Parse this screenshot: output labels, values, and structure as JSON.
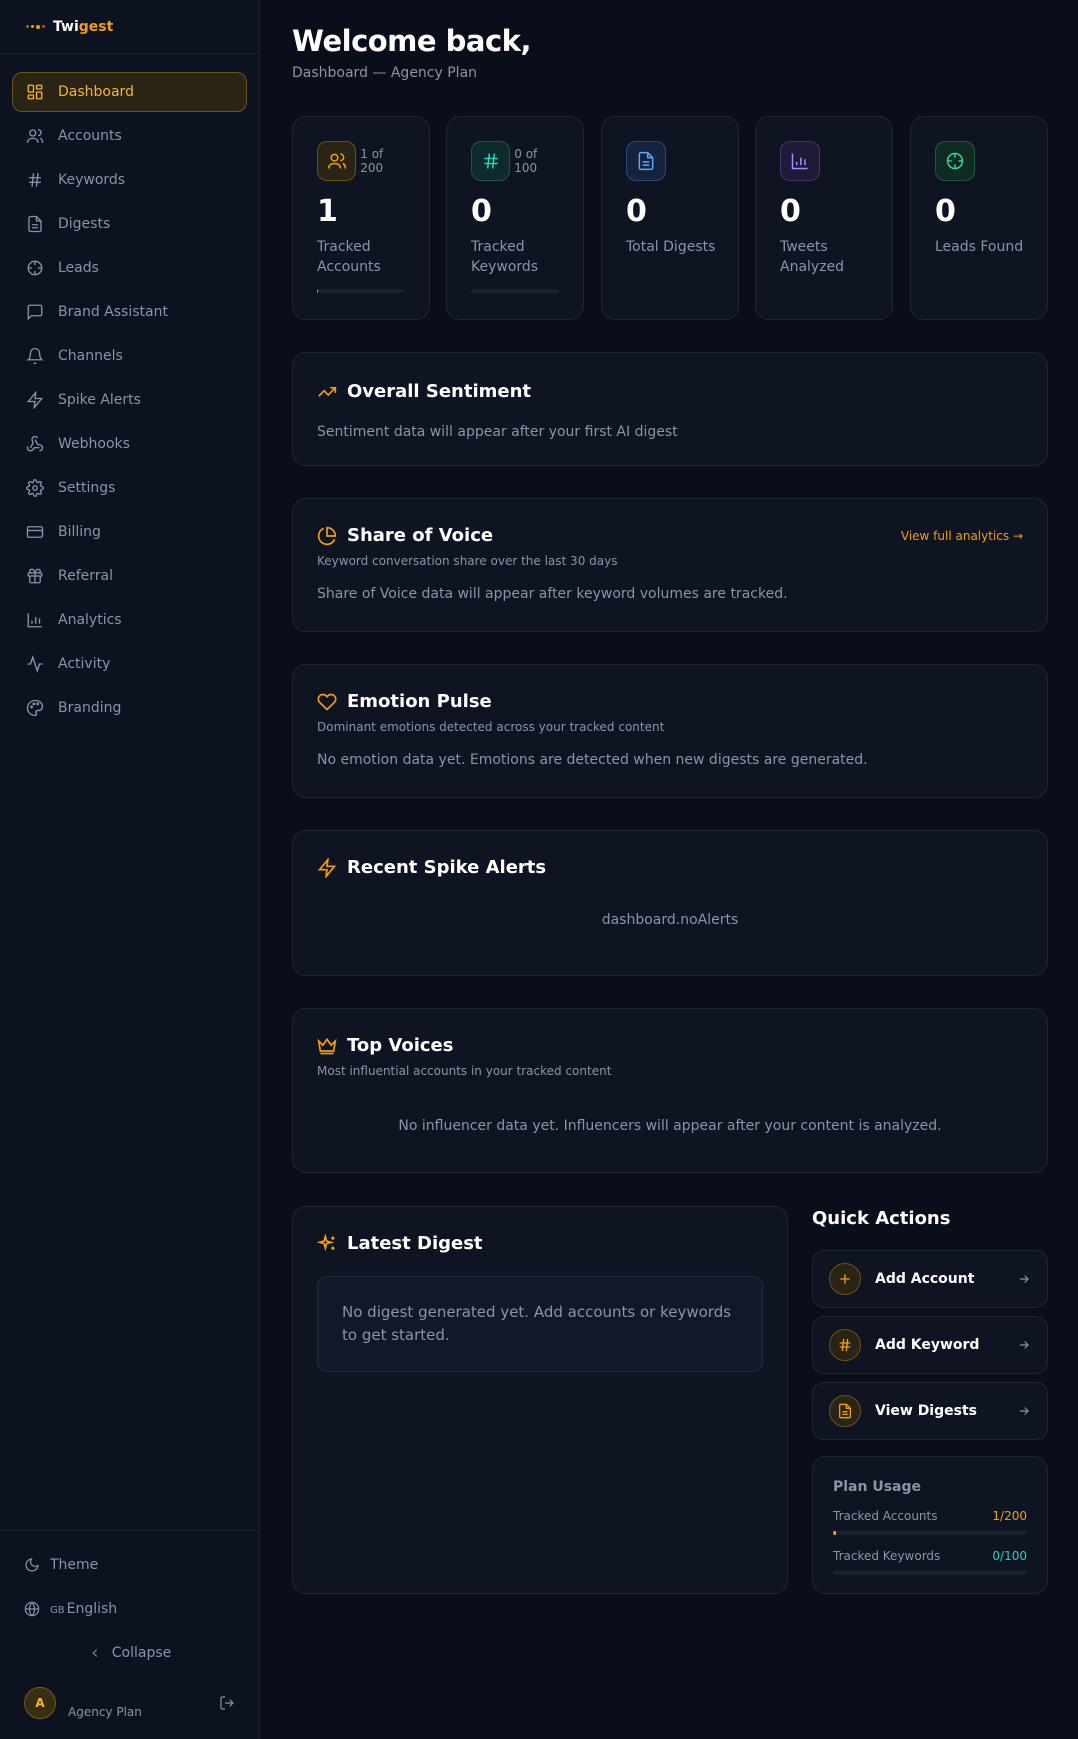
{
  "app": {
    "name_part1": "Twi",
    "name_part2": "gest"
  },
  "sidebar": {
    "items": [
      {
        "label": "Dashboard",
        "icon": "dashboard-icon",
        "active": true
      },
      {
        "label": "Accounts",
        "icon": "users-icon"
      },
      {
        "label": "Keywords",
        "icon": "hash-icon"
      },
      {
        "label": "Digests",
        "icon": "file-icon"
      },
      {
        "label": "Leads",
        "icon": "crosshair-icon"
      },
      {
        "label": "Brand Assistant",
        "icon": "chat-icon"
      },
      {
        "label": "Channels",
        "icon": "bell-icon"
      },
      {
        "label": "Spike Alerts",
        "icon": "zap-icon"
      },
      {
        "label": "Webhooks",
        "icon": "webhook-icon"
      },
      {
        "label": "Settings",
        "icon": "gear-icon"
      },
      {
        "label": "Billing",
        "icon": "credit-card-icon"
      },
      {
        "label": "Referral",
        "icon": "gift-icon"
      },
      {
        "label": "Analytics",
        "icon": "bar-chart-icon"
      },
      {
        "label": "Activity",
        "icon": "activity-icon"
      },
      {
        "label": "Branding",
        "icon": "palette-icon"
      }
    ],
    "theme_label": "Theme",
    "language_flag": "GB",
    "language_label": "English",
    "collapse_label": "Collapse",
    "user_initial": "A",
    "user_plan": "Agency Plan"
  },
  "header": {
    "title": "Welcome back,",
    "subtitle": "Dashboard — Agency Plan"
  },
  "stats": [
    {
      "limit": "1 of 200",
      "value": "1",
      "label": "Tracked Accounts",
      "progress": 0.005,
      "color": "#f59e0b"
    },
    {
      "limit": "0 of 100",
      "value": "0",
      "label": "Tracked Keywords",
      "progress": 0,
      "color": "#2dd4bf"
    },
    {
      "limit": "",
      "value": "0",
      "label": "Total Digests",
      "color": "#60a5fa"
    },
    {
      "limit": "",
      "value": "0",
      "label": "Tweets Analyzed",
      "color": "#a78bfa"
    },
    {
      "limit": "",
      "value": "0",
      "label": "Leads Found",
      "color": "#34d399"
    }
  ],
  "sentiment": {
    "title": "Overall Sentiment",
    "body": "Sentiment data will appear after your first AI digest"
  },
  "share_of_voice": {
    "title": "Share of Voice",
    "subtitle": "Keyword conversation share over the last 30 days",
    "link": "View full analytics →",
    "body": "Share of Voice data will appear after keyword volumes are tracked."
  },
  "emotion": {
    "title": "Emotion Pulse",
    "subtitle": "Dominant emotions detected across your tracked content",
    "body": "No emotion data yet. Emotions are detected when new digests are generated."
  },
  "spikes": {
    "title": "Recent Spike Alerts",
    "body": "dashboard.noAlerts"
  },
  "top_voices": {
    "title": "Top Voices",
    "subtitle": "Most influential accounts in your tracked content",
    "body": "No influencer data yet. Influencers will appear after your content is analyzed."
  },
  "latest_digest": {
    "title": "Latest Digest",
    "body": "No digest generated yet. Add accounts or keywords to get started."
  },
  "quick_actions": {
    "title": "Quick Actions",
    "items": [
      {
        "label": "Add Account",
        "icon": "plus-icon"
      },
      {
        "label": "Add Keyword",
        "icon": "hash-icon"
      },
      {
        "label": "View Digests",
        "icon": "file-icon"
      }
    ]
  },
  "plan_usage": {
    "title": "Plan Usage",
    "rows": [
      {
        "label": "Tracked Accounts",
        "value": "1/200",
        "progress": 0.005,
        "color": "#f59e0b"
      },
      {
        "label": "Tracked Keywords",
        "value": "0/100",
        "progress": 0,
        "color": "#2dd4bf"
      }
    ]
  }
}
